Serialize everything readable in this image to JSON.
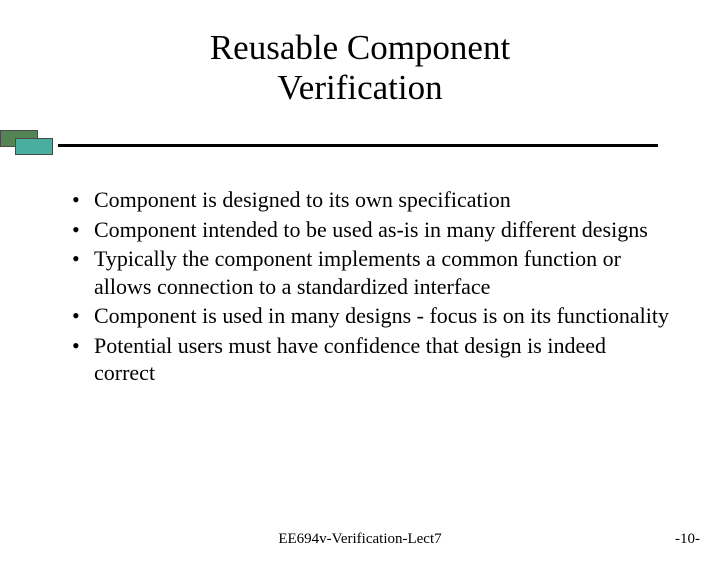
{
  "title_line1": "Reusable Component",
  "title_line2": "Verification",
  "bullets": [
    "Component is designed to its own specification",
    "Component intended to be used as-is in many different designs",
    "Typically the component implements a common function or allows connection to a standardized interface",
    "Component is used in many designs - focus is on its functionality",
    "Potential users must have confidence that design is indeed correct"
  ],
  "footer_center": "EE694v-Verification-Lect7",
  "footer_right": "-10-"
}
